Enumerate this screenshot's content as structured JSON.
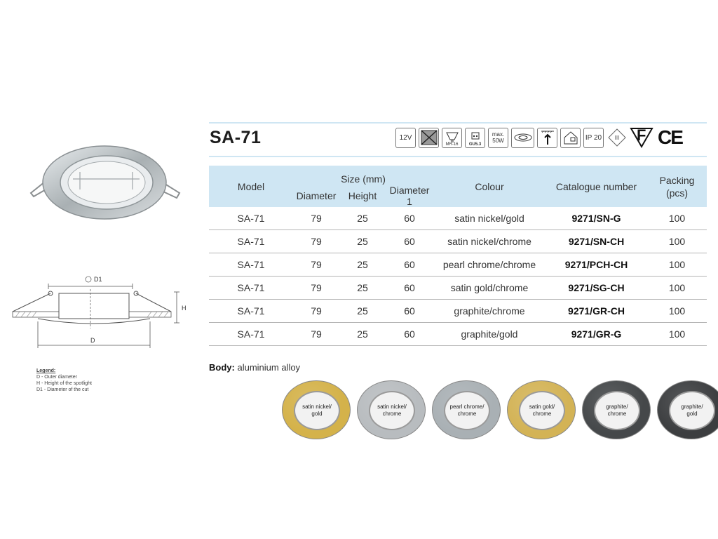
{
  "title": "SA-71",
  "icons": [
    {
      "name": "12v-icon",
      "label": "12V"
    },
    {
      "name": "no-insulation-cover-icon",
      "label": ""
    },
    {
      "name": "mr16-lamp-icon",
      "label": "MR-16"
    },
    {
      "name": "gu53-socket-icon",
      "label": "GU5.3"
    },
    {
      "name": "max-wattage-icon",
      "label": "max. 50W"
    },
    {
      "name": "recessed-fixture-icon",
      "label": ""
    },
    {
      "name": "ceiling-mount-icon",
      "label": ""
    },
    {
      "name": "indoor-use-icon",
      "label": ""
    },
    {
      "name": "ip-rating-icon",
      "label": "IP 20"
    },
    {
      "name": "protection-class-icon",
      "label": "III"
    }
  ],
  "marks": {
    "f": "F",
    "ce": "CE"
  },
  "table": {
    "headers": {
      "model": "Model",
      "size": "Size (mm)",
      "diameter": "Diameter",
      "height": "Height",
      "diameter1": "Diameter 1",
      "colour": "Colour",
      "catalogue": "Catalogue number",
      "packing": "Packing (pcs)"
    },
    "rows": [
      {
        "model": "SA-71",
        "diameter": "79",
        "height": "25",
        "diameter1": "60",
        "colour": "satin nickel/gold",
        "catalogue": "9271/SN-G",
        "packing": "100"
      },
      {
        "model": "SA-71",
        "diameter": "79",
        "height": "25",
        "diameter1": "60",
        "colour": "satin nickel/chrome",
        "catalogue": "9271/SN-CH",
        "packing": "100"
      },
      {
        "model": "SA-71",
        "diameter": "79",
        "height": "25",
        "diameter1": "60",
        "colour": "pearl chrome/chrome",
        "catalogue": "9271/PCH-CH",
        "packing": "100"
      },
      {
        "model": "SA-71",
        "diameter": "79",
        "height": "25",
        "diameter1": "60",
        "colour": "satin gold/chrome",
        "catalogue": "9271/SG-CH",
        "packing": "100"
      },
      {
        "model": "SA-71",
        "diameter": "79",
        "height": "25",
        "diameter1": "60",
        "colour": "graphite/chrome",
        "catalogue": "9271/GR-CH",
        "packing": "100"
      },
      {
        "model": "SA-71",
        "diameter": "79",
        "height": "25",
        "diameter1": "60",
        "colour": "graphite/gold",
        "catalogue": "9271/GR-G",
        "packing": "100"
      }
    ]
  },
  "body": {
    "label": "Body:",
    "value": "aluminium alloy"
  },
  "diagram": {
    "d1": "D1",
    "h": "H",
    "d": "D"
  },
  "legend": {
    "title": "Legend:",
    "items": [
      "D - Outer diameter",
      "H - Height of the spotlight",
      "D1 - Diameter of the cut"
    ]
  },
  "swatches": [
    {
      "line1": "satin nickel/",
      "line2": "gold",
      "outer": "#d4b24a"
    },
    {
      "line1": "satin nickel/",
      "line2": "chrome",
      "outer": "#b8bcbf"
    },
    {
      "line1": "pearl chrome/",
      "line2": "chrome",
      "outer": "#a9b0b4"
    },
    {
      "line1": "satin gold/",
      "line2": "chrome",
      "outer": "#d3b356"
    },
    {
      "line1": "graphite/",
      "line2": "chrome",
      "outer": "#45484a"
    },
    {
      "line1": "graphite/",
      "line2": "gold",
      "outer": "#3c3e40"
    }
  ],
  "colors": {
    "accent": "#cfe6f3",
    "rule": "#b5b5b5"
  }
}
